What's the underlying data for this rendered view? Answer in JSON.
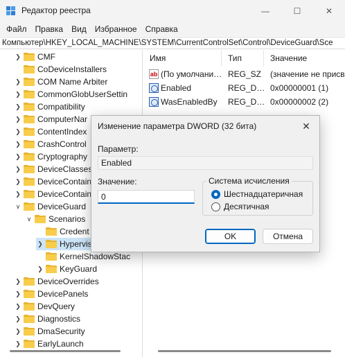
{
  "window": {
    "title": "Редактор реестра",
    "controls": {
      "minimize": "—",
      "maximize": "☐",
      "close": "✕"
    }
  },
  "menu": [
    "Файл",
    "Правка",
    "Вид",
    "Избранное",
    "Справка"
  ],
  "address": "Компьютер\\HKEY_LOCAL_MACHINE\\SYSTEM\\CurrentControlSet\\Control\\DeviceGuard\\Sce",
  "tree": [
    {
      "label": "CMF",
      "expanded": false
    },
    {
      "label": "CoDeviceInstallers",
      "expanded": false
    },
    {
      "label": "COM Name Arbiter",
      "expanded": false
    },
    {
      "label": "CommonGlobUserSettin",
      "expanded": false
    },
    {
      "label": "Compatibility",
      "expanded": false
    },
    {
      "label": "ComputerNar",
      "expanded": false
    },
    {
      "label": "ContentIndex",
      "expanded": false
    },
    {
      "label": "CrashControl",
      "expanded": false
    },
    {
      "label": "Cryptography",
      "expanded": false
    },
    {
      "label": "DeviceClasses",
      "expanded": false
    },
    {
      "label": "DeviceContain",
      "expanded": false
    },
    {
      "label": "DeviceContain",
      "expanded": false
    },
    {
      "label": "DeviceGuard",
      "expanded": true
    },
    {
      "label": "Scenarios",
      "expanded": true
    },
    {
      "label": "Credent",
      "expanded": false
    },
    {
      "label": "Hypervis",
      "expanded": false,
      "selected": true
    },
    {
      "label": "KernelShadowStac",
      "expanded": false
    },
    {
      "label": "KeyGuard",
      "expanded": false
    },
    {
      "label": "DeviceOverrides",
      "expanded": false
    },
    {
      "label": "DevicePanels",
      "expanded": false
    },
    {
      "label": "DevQuery",
      "expanded": false
    },
    {
      "label": "Diagnostics",
      "expanded": false
    },
    {
      "label": "DmaSecurity",
      "expanded": false
    },
    {
      "label": "EarlyLaunch",
      "expanded": false
    }
  ],
  "list": {
    "columns": [
      "Имя",
      "Тип",
      "Значение"
    ],
    "rows": [
      {
        "icon": "string-value-icon",
        "name": "(По умолчани…",
        "type": "REG_SZ",
        "value": "(значение не присв"
      },
      {
        "icon": "dword-value-icon",
        "name": "Enabled",
        "type": "REG_D…",
        "value": "0x00000001 (1)"
      },
      {
        "icon": "dword-value-icon",
        "name": "WasEnabledBy",
        "type": "REG_D…",
        "value": "0x00000002 (2)"
      }
    ]
  },
  "dialog": {
    "title": "Изменение параметра DWORD (32 бита)",
    "close": "✕",
    "param_label": "Параметр:",
    "param_value": "Enabled",
    "value_label": "Значение:",
    "value": "0",
    "base_group": "Система исчисления",
    "base_hex": "Шестнадцатеричная",
    "base_dec": "Десятичная",
    "ok": "OK",
    "cancel": "Отмена"
  }
}
